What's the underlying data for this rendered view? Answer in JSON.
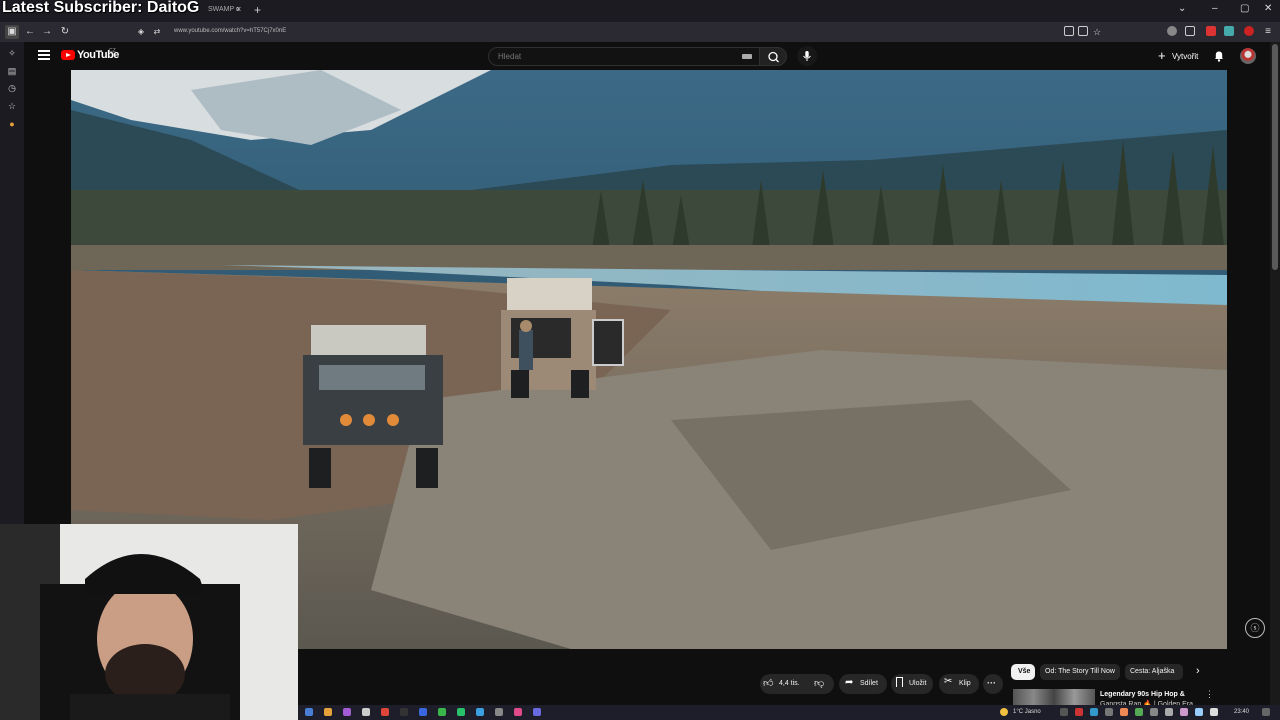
{
  "overlay": {
    "subscriber_text": "Latest Subscriber: DaitoG"
  },
  "browser": {
    "tab_title": "SWAMP c",
    "tab_close": "×",
    "new_tab": "+",
    "window_controls": [
      "⌄",
      "–",
      "▢",
      "✕"
    ],
    "url": "www.youtube.com/watch?v=hT57Cj7x0nE"
  },
  "youtube": {
    "logo_text": "YouTube",
    "country_code": "CZ",
    "search_placeholder": "Hledat",
    "create_label": "Vytvořit",
    "create_plus": "+"
  },
  "actions": {
    "likes": "4,4 tis.",
    "share": "Sdílet",
    "save": "Uložit",
    "clip": "Klip",
    "more": "···"
  },
  "chips": {
    "all": "Vše",
    "from": "Od: The Story Till Now",
    "travel": "Cesta: Aljaška",
    "next": "›"
  },
  "recommendation": {
    "title": "Legendary 90s Hip Hop &",
    "title_line2": "Gangsta Rap 🔥 | Golden Era",
    "more": "⋮"
  },
  "taskbar": {
    "weather": "1°C  Jasno",
    "time": "23:40"
  },
  "video_badge": "ⓢ",
  "colors": {
    "yt_red": "#ff0000",
    "bg": "#0f0f0f",
    "chip_active": "#f1f1f1"
  }
}
